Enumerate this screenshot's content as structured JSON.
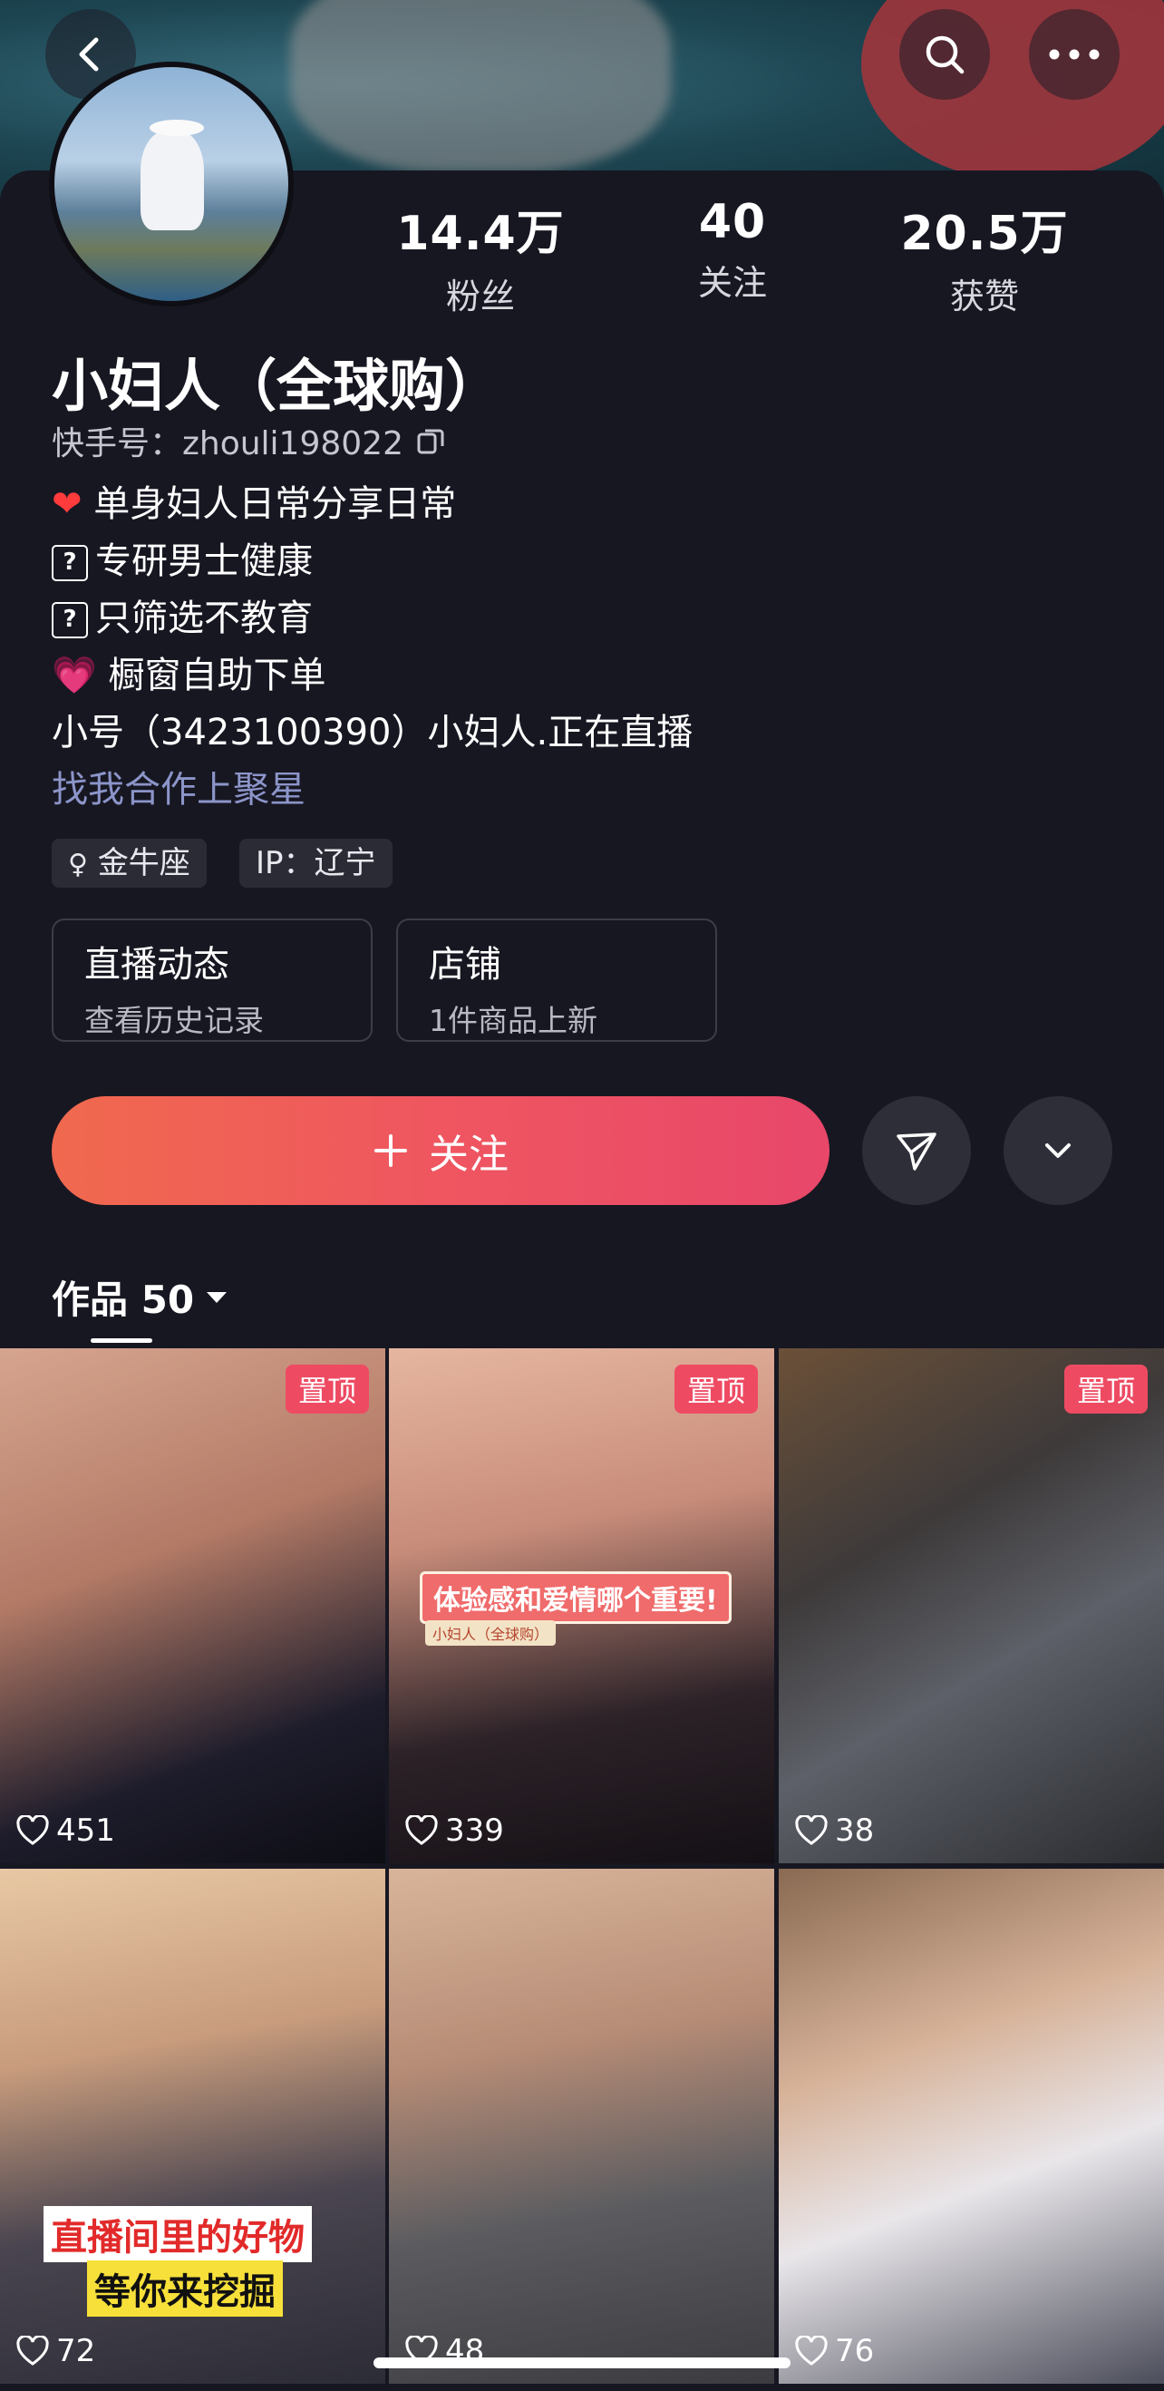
{
  "header": {
    "back_icon": "chevron-left-icon",
    "search_icon": "search-icon",
    "more_icon": "more-horizontal-icon"
  },
  "profile": {
    "stats": [
      {
        "value": "14.4万",
        "label": "粉丝"
      },
      {
        "value": "40",
        "label": "关注"
      },
      {
        "value": "20.5万",
        "label": "获赞"
      }
    ],
    "name": "小妇人（全球购）",
    "id_label": "快手号：zhouli198022",
    "bio": [
      {
        "icon": "❤️",
        "text": "单身妇人日常分享日常"
      },
      {
        "icon": "?",
        "text": "专研男士健康"
      },
      {
        "icon": "?",
        "text": "只筛选不教育"
      },
      {
        "icon": "💗",
        "text": "橱窗自助下单"
      }
    ],
    "bio_extra": "小号（3423100390）小妇人.正在直播",
    "link_text": "找我合作上聚星",
    "tags": [
      "金牛座",
      "IP：辽宁"
    ]
  },
  "cards": [
    {
      "title": "直播动态",
      "subtitle": "查看历史记录"
    },
    {
      "title": "店铺",
      "subtitle": "1件商品上新"
    }
  ],
  "actions": {
    "follow_label": "关注",
    "share_icon": "send-icon",
    "dropdown_icon": "chevron-down-icon"
  },
  "works_tab": {
    "label": "作品 50"
  },
  "works": [
    {
      "likes": "451",
      "pinned": "置顶",
      "caption": ""
    },
    {
      "likes": "339",
      "pinned": "置顶",
      "caption": "体验感和爱情哪个重要!",
      "sub_caption": "小妇人（全球购）"
    },
    {
      "likes": "38",
      "pinned": "置顶",
      "caption": ""
    },
    {
      "likes": "72",
      "pinned": "",
      "caption": "直播间里的好物",
      "caption2": "等你来挖掘"
    },
    {
      "likes": "48",
      "pinned": "",
      "caption": ""
    },
    {
      "likes": "76",
      "pinned": "",
      "caption": ""
    }
  ],
  "colors": {
    "accent": "#ef5660",
    "background": "#171722",
    "link": "#8c95c9"
  }
}
